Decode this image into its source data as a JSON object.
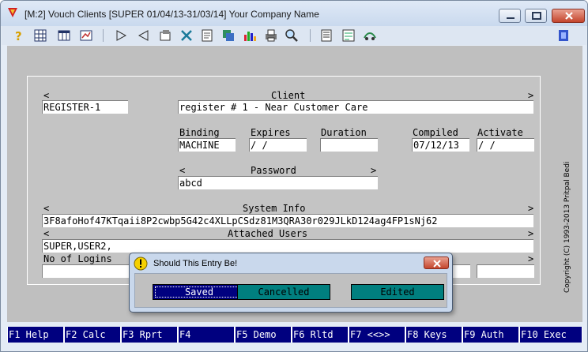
{
  "window": {
    "title": "[M:2]  Vouch Clients  [SUPER  01/04/13-31/03/14]  Your Company Name"
  },
  "toolbar": {
    "icons": [
      "help-icon",
      "grid-icon",
      "table-icon",
      "report-icon",
      "play-icon",
      "back-icon",
      "form-icon",
      "tools-icon",
      "document-icon",
      "copy-icon",
      "chart-icon",
      "print-icon",
      "find-icon",
      "notes-icon",
      "settings-icon",
      "link-icon",
      "exit-icon"
    ]
  },
  "form": {
    "left_arrow": "<",
    "right_arrow": ">",
    "client_header": "Client",
    "client_code": "REGISTER-1",
    "client_name": "register # 1 - Near Customer Care",
    "binding_label": "Binding",
    "binding_value": "MACHINE",
    "expires_label": "Expires",
    "expires_value": " /  /",
    "duration_label": "Duration",
    "duration_value": "",
    "compiled_label": "Compiled",
    "compiled_value": "07/12/13",
    "activate_label": "Activate",
    "activate_value": " /  /",
    "password_label": "Password",
    "password_value": "abcd",
    "system_info_label": "System Info",
    "system_info_value": "3F8afoHof47KTqaii8P2cwbp5G42c4XLLpCSdz81M3QRA30r029JLkD124ag4FP1sNj62",
    "attached_users_label": "Attached Users",
    "attached_users_value": "SUPER,USER2,",
    "logins_label": "No of Logins",
    "logins_value": "",
    "field_right_value": ""
  },
  "copyright": "Copyright (C) 1993-2013  Pritpal Bedi",
  "fkeys": [
    {
      "label": "F1 Help"
    },
    {
      "label": "F2 Calc"
    },
    {
      "label": "F3 Rprt"
    },
    {
      "label": "F4"
    },
    {
      "label": "F5 Demo"
    },
    {
      "label": "F6 Rltd"
    },
    {
      "label": "F7 <<>>"
    },
    {
      "label": "F8 Keys"
    },
    {
      "label": "F9 Auth"
    },
    {
      "label": "F10 Exec"
    }
  ],
  "dialog": {
    "title": "Should This Entry Be!",
    "saved": "Saved",
    "cancelled": "Cancelled",
    "edited": "Edited"
  }
}
